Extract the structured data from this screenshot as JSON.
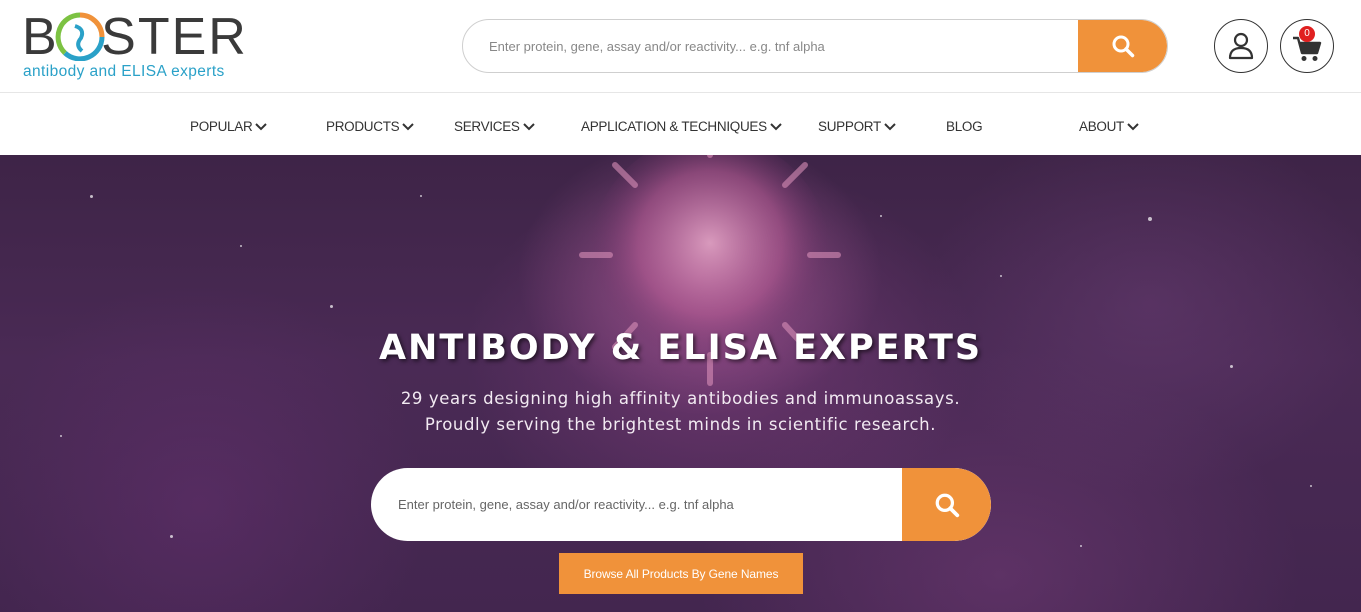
{
  "brand": {
    "logo_text": "BOSTER",
    "tagline": "antibody and ELISA experts",
    "colors": {
      "logo_text": "#3a3a3a",
      "tagline": "#2aa1c8",
      "mark_orange": "#f0923a",
      "mark_blue": "#2aa1c8",
      "mark_green": "#7cc242"
    }
  },
  "header": {
    "search": {
      "placeholder": "Enter protein, gene, assay and/or reactivity... e.g. tnf alpha",
      "value": "",
      "icon": "search-icon"
    },
    "account": {
      "icon": "user-icon"
    },
    "cart": {
      "icon": "cart-icon",
      "count": "0"
    }
  },
  "nav": {
    "items": [
      {
        "label": "POPULAR",
        "has_dropdown": true
      },
      {
        "label": "PRODUCTS",
        "has_dropdown": true
      },
      {
        "label": "SERVICES",
        "has_dropdown": true
      },
      {
        "label": "APPLICATION & TECHNIQUES",
        "has_dropdown": true
      },
      {
        "label": "SUPPORT",
        "has_dropdown": true
      },
      {
        "label": "BLOG",
        "has_dropdown": false
      },
      {
        "label": "ABOUT",
        "has_dropdown": true
      }
    ]
  },
  "hero": {
    "title": "ANTIBODY & ELISA EXPERTS",
    "subtitle_line1": "29 years designing high affinity antibodies and immunoassays.",
    "subtitle_line2": "Proudly serving the brightest minds in scientific research.",
    "search": {
      "placeholder": "Enter protein, gene, assay and/or reactivity... e.g. tnf alpha",
      "value": "",
      "icon": "search-icon"
    },
    "browse_button": "Browse All Products By Gene Names"
  },
  "colors": {
    "accent": "#f0923a",
    "badge": "#e02020",
    "hero_bg": "#43264f",
    "nav_text": "#333333"
  }
}
